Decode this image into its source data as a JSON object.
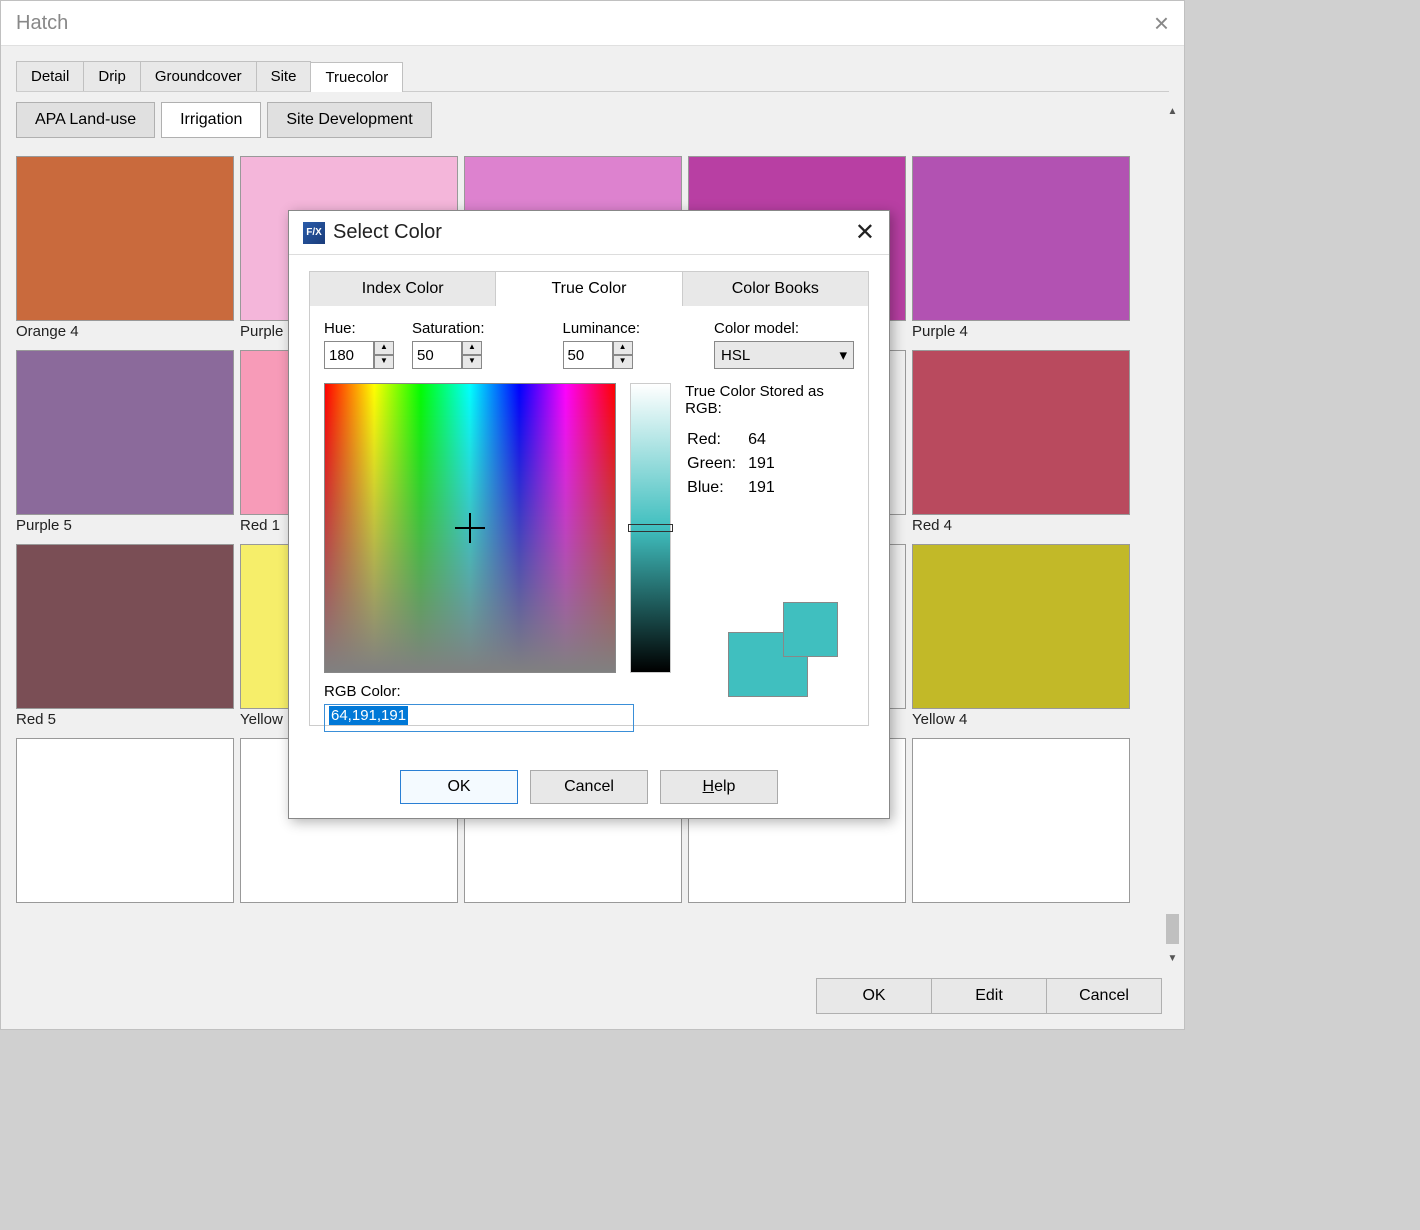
{
  "main": {
    "title": "Hatch",
    "tabs": [
      "Detail",
      "Drip",
      "Groundcover",
      "Site",
      "Truecolor"
    ],
    "active_tab": 4,
    "subtabs": [
      "APA Land-use",
      "Irrigation",
      "Site Development"
    ],
    "active_subtab": 1,
    "swatches": [
      {
        "label": "Orange 4",
        "color": "#c96a3d"
      },
      {
        "label": "Purple",
        "color": "#f4b6da"
      },
      {
        "label": "",
        "color": "#dd82cf"
      },
      {
        "label": "",
        "color": "#b83fa3"
      },
      {
        "label": "Purple 4",
        "color": "#b252b2"
      },
      {
        "label": "Purple 5",
        "color": "#8b6a9b"
      },
      {
        "label": "Red 1",
        "color": "#f79bb8"
      },
      {
        "label": "",
        "color": ""
      },
      {
        "label": "",
        "color": ""
      },
      {
        "label": "Red 4",
        "color": "#b94a5e"
      },
      {
        "label": "Red 5",
        "color": "#7a4e55"
      },
      {
        "label": "Yellow",
        "color": "#f6ee6a"
      },
      {
        "label": "",
        "color": ""
      },
      {
        "label": "",
        "color": ""
      },
      {
        "label": "Yellow 4",
        "color": "#c2b928"
      },
      {
        "label": "",
        "color": "",
        "empty": true
      },
      {
        "label": "",
        "color": "",
        "empty": true
      },
      {
        "label": "",
        "color": "",
        "empty": true
      },
      {
        "label": "",
        "color": "",
        "empty": true
      },
      {
        "label": "",
        "color": "",
        "empty": true
      }
    ],
    "buttons": {
      "ok": "OK",
      "edit": "Edit",
      "cancel": "Cancel"
    }
  },
  "dialog": {
    "icon_text": "F/X",
    "title": "Select Color",
    "tabs": [
      "Index Color",
      "True Color",
      "Color Books"
    ],
    "active_tab": 1,
    "hsl": {
      "hue_label": "Hue:",
      "hue": "180",
      "sat_label": "Saturation:",
      "sat": "50",
      "lum_label": "Luminance:",
      "lum": "50"
    },
    "color_model_label": "Color model:",
    "color_model": "HSL",
    "stored_label": "True Color Stored as RGB:",
    "rgb": {
      "red_label": "Red:",
      "red": "64",
      "green_label": "Green:",
      "green": "191",
      "blue_label": "Blue:",
      "blue": "191"
    },
    "rgb_field_label": "RGB Color:",
    "rgb_field_value": "64,191,191",
    "preview_color": "#40bfbf",
    "buttons": {
      "ok": "OK",
      "cancel": "Cancel",
      "help": "Help"
    }
  }
}
